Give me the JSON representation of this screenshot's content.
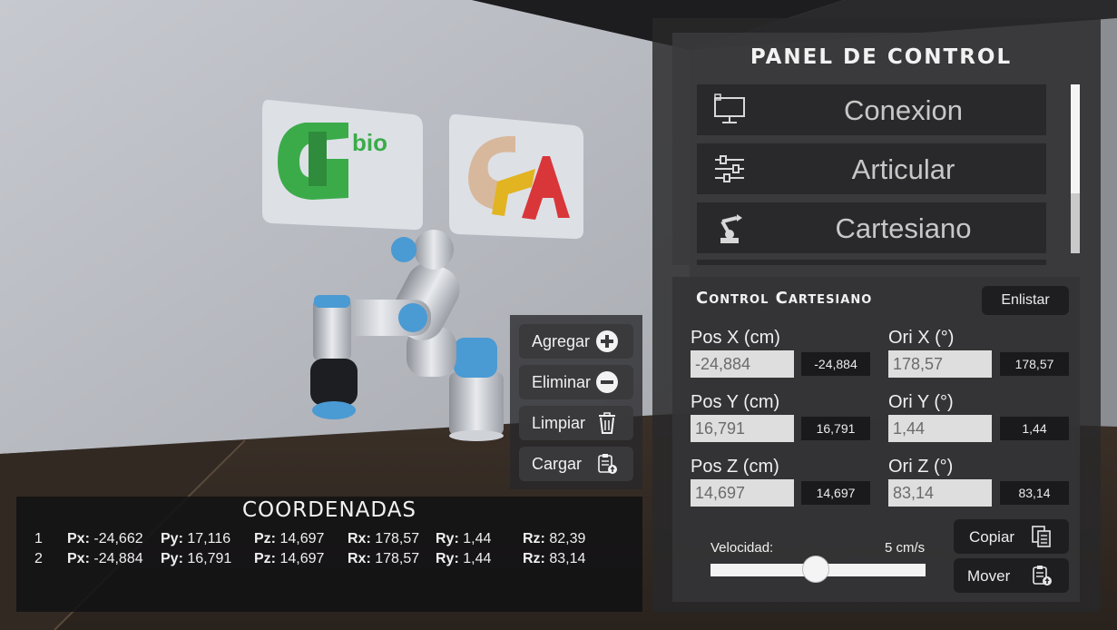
{
  "panel": {
    "title": "PANEL DE CONTROL",
    "menu": [
      {
        "label": "Conexion",
        "icon": "monitor-icon"
      },
      {
        "label": "Articular",
        "icon": "sliders-icon"
      },
      {
        "label": "Cartesiano",
        "icon": "robot-arm-icon"
      }
    ]
  },
  "cartesian": {
    "title": "Control Cartesiano",
    "list_button": "Enlistar",
    "fields": [
      {
        "label": "Pos X (cm)",
        "value": "-24,884",
        "readout": "-24,884"
      },
      {
        "label": "Ori X (°)",
        "value": "178,57",
        "readout": "178,57"
      },
      {
        "label": "Pos Y (cm)",
        "value": "16,791",
        "readout": "16,791"
      },
      {
        "label": "Ori Y (°)",
        "value": "1,44",
        "readout": "1,44"
      },
      {
        "label": "Pos Z (cm)",
        "value": "14,697",
        "readout": "14,697"
      },
      {
        "label": "Ori Z (°)",
        "value": "83,14",
        "readout": "83,14"
      }
    ],
    "speed_label": "Velocidad:",
    "speed_value": "5 cm/s",
    "speed_fraction": 0.49,
    "copy_button": "Copiar",
    "move_button": "Mover"
  },
  "actions": {
    "add": "Agregar",
    "delete": "Eliminar",
    "clear": "Limpiar",
    "load": "Cargar"
  },
  "coords": {
    "title": "COORDENADAS",
    "keys": {
      "px": "Px:",
      "py": "Py:",
      "pz": "Pz:",
      "rx": "Rx:",
      "ry": "Ry:",
      "rz": "Rz:"
    },
    "rows": [
      {
        "n": "1",
        "px": "-24,662",
        "py": "17,116",
        "pz": "14,697",
        "rx": "178,57",
        "ry": "1,44",
        "rz": "82,39"
      },
      {
        "n": "2",
        "px": "-24,884",
        "py": "16,791",
        "pz": "14,697",
        "rx": "178,57",
        "ry": "1,44",
        "rz": "83,14"
      }
    ]
  },
  "logos": {
    "left_text": "bio"
  },
  "colors": {
    "green_logo": "#3bab4a",
    "red_logo": "#d9363a",
    "yellow_logo": "#e2b422",
    "robot_accent": "#4a9ad4"
  }
}
